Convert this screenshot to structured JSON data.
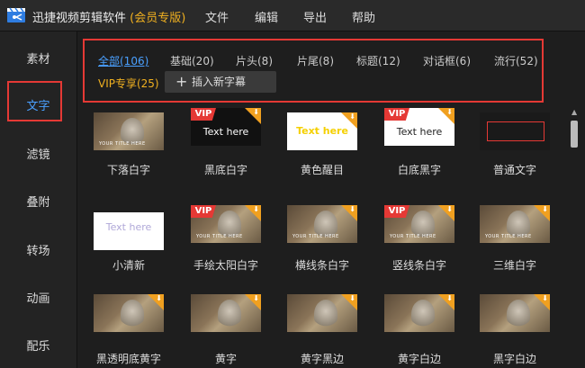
{
  "titlebar": {
    "app_name": "迅捷视频剪辑软件",
    "edition": "(会员专版)",
    "menu": [
      "文件",
      "编辑",
      "导出",
      "帮助"
    ]
  },
  "sidebar": {
    "items": [
      "素材",
      "文字",
      "滤镜",
      "叠附",
      "转场",
      "动画",
      "配乐"
    ],
    "active": "文字"
  },
  "filters": {
    "tabs": [
      "全部(106)",
      "基础(20)",
      "片头(8)",
      "片尾(8)",
      "标题(12)",
      "对话框(6)",
      "流行(52)"
    ],
    "vip_tab": "VIP专享(25)",
    "insert_label": "插入新字幕"
  },
  "thumb_texts": {
    "text_here": "Text here",
    "text_here_light": "Text  here",
    "vip": "VIP",
    "small_sub": "YOUR TITLE HERE"
  },
  "items": [
    "下落白字",
    "黑底白字",
    "黄色醒目",
    "白底黑字",
    "普通文字",
    "小清新",
    "手绘太阳白字",
    "横线条白字",
    "竖线条白字",
    "三维白字",
    "黑透明底黄字",
    "黄字",
    "黄字黑边",
    "黄字白边",
    "黑字白边"
  ],
  "colors": {
    "accent_blue": "#4aa0ff",
    "vip_gold": "#f0b020",
    "highlight_red": "#e53935",
    "background": "#1b1b1b"
  }
}
